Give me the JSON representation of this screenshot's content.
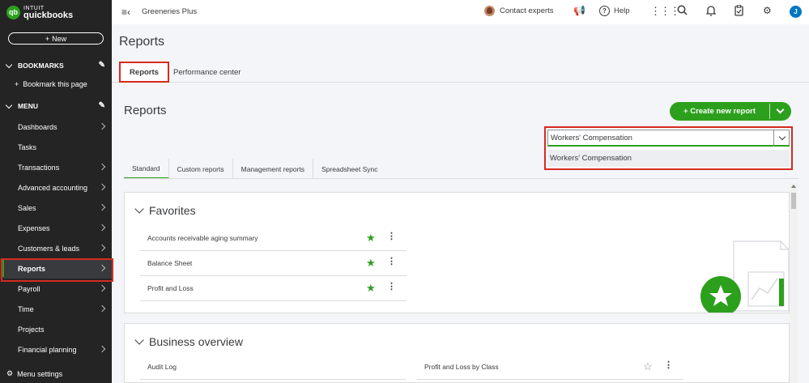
{
  "brand": {
    "small": "INTUIT",
    "name": "quickbooks",
    "mark": "qb"
  },
  "sidebar": {
    "new_label": "New",
    "bookmarks_title": "BOOKMARKS",
    "bookmark_item": "Bookmark this page",
    "menu_title": "MENU",
    "items": [
      {
        "label": "Dashboards",
        "arrow": true
      },
      {
        "label": "Tasks",
        "arrow": false
      },
      {
        "label": "Transactions",
        "arrow": true
      },
      {
        "label": "Advanced accounting",
        "arrow": true
      },
      {
        "label": "Sales",
        "arrow": true
      },
      {
        "label": "Expenses",
        "arrow": true
      },
      {
        "label": "Customers & leads",
        "arrow": true
      },
      {
        "label": "Reports",
        "arrow": true,
        "active": true
      },
      {
        "label": "Payroll",
        "arrow": true
      },
      {
        "label": "Time",
        "arrow": true
      },
      {
        "label": "Projects",
        "arrow": false
      },
      {
        "label": "Financial planning",
        "arrow": true
      }
    ],
    "menu_settings": "Menu settings"
  },
  "topbar": {
    "company": "Greeneries Plus",
    "contact": "Contact experts",
    "help": "Help",
    "user_initial": "J"
  },
  "page": {
    "title": "Reports",
    "tabs": [
      "Reports",
      "Performance center"
    ]
  },
  "main": {
    "heading": "Reports",
    "create_label": "+ Create new report",
    "search_value": "Workers' Compensation",
    "search_option": "Workers' Compensation",
    "sub_tabs": [
      "Standard",
      "Custom reports",
      "Management reports",
      "Spreadsheet Sync"
    ]
  },
  "favorites": {
    "title": "Favorites",
    "rows": [
      {
        "label": "Accounts receivable aging summary",
        "starred": true
      },
      {
        "label": "Balance Sheet",
        "starred": true
      },
      {
        "label": "Profit and Loss",
        "starred": true
      }
    ]
  },
  "business_overview": {
    "title": "Business overview",
    "rows": [
      {
        "label": "Audit Log"
      },
      {
        "label": "Profit and Loss by Class",
        "starred": false
      }
    ]
  },
  "colors": {
    "brand_green": "#2ca01c",
    "highlight_red": "#d52b1e",
    "sidebar_bg": "#242424"
  }
}
